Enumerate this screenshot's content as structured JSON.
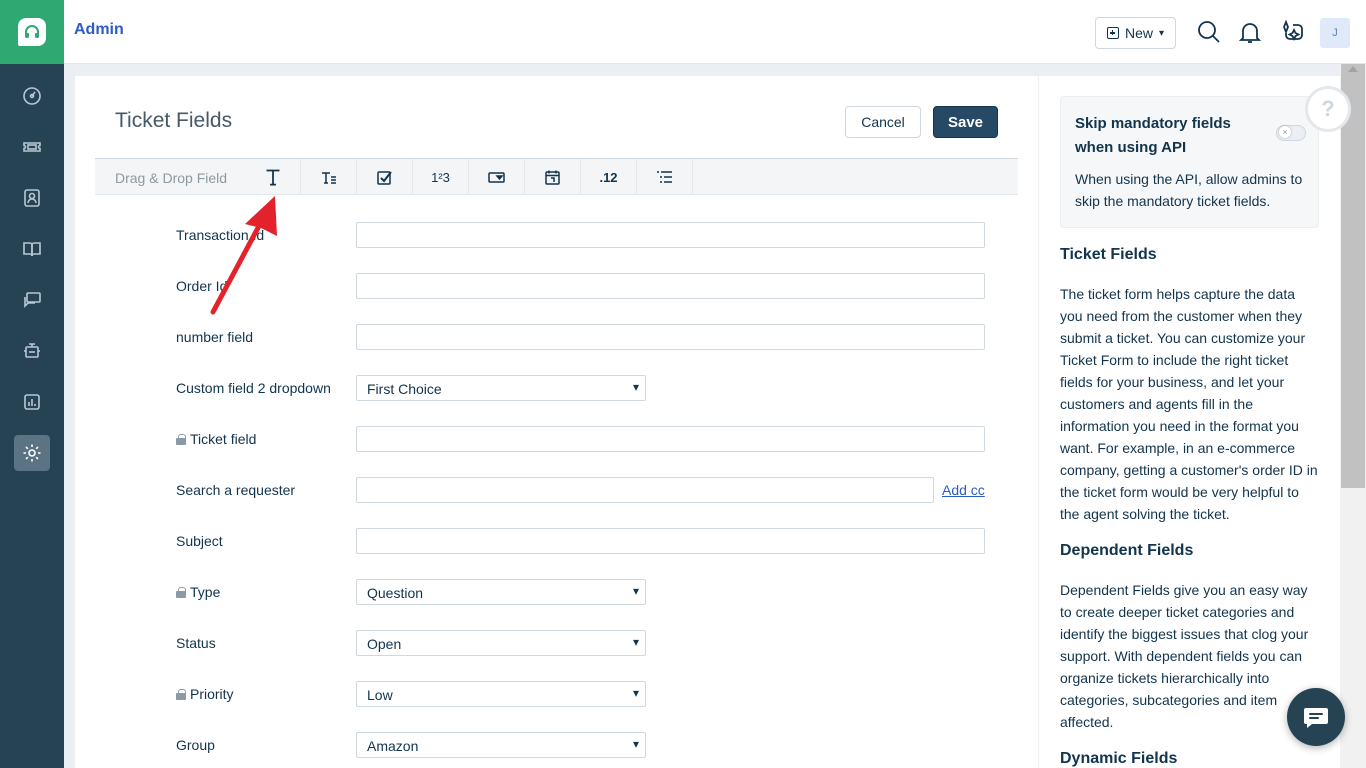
{
  "topbar": {
    "breadcrumb": "Admin",
    "new_button_label": "New",
    "avatar_initial": "J"
  },
  "page": {
    "title": "Ticket Fields",
    "cancel_label": "Cancel",
    "save_label": "Save"
  },
  "toolbar": {
    "label": "Drag & Drop Field",
    "tools": [
      {
        "icon": "single-line-text-icon"
      },
      {
        "icon": "multi-line-text-icon"
      },
      {
        "icon": "checkbox-icon"
      },
      {
        "icon": "number-icon",
        "text": "1²3"
      },
      {
        "icon": "dropdown-icon"
      },
      {
        "icon": "date-icon"
      },
      {
        "icon": "decimal-icon",
        "text": ".12"
      },
      {
        "icon": "dependent-field-icon"
      }
    ]
  },
  "fields": [
    {
      "label": "Transaction Id",
      "type": "text"
    },
    {
      "label": "Order Id",
      "type": "text"
    },
    {
      "label": "number field",
      "type": "text"
    },
    {
      "label": "Custom field 2 dropdown",
      "type": "select",
      "value": "First Choice"
    },
    {
      "label": "Ticket field",
      "type": "text",
      "locked": true
    },
    {
      "label": "Search a requester",
      "type": "text",
      "link": "Add cc"
    },
    {
      "label": "Subject",
      "type": "text"
    },
    {
      "label": "Type",
      "type": "select",
      "value": "Question",
      "locked": true
    },
    {
      "label": "Status",
      "type": "select",
      "value": "Open"
    },
    {
      "label": "Priority",
      "type": "select",
      "value": "Low",
      "locked": true
    },
    {
      "label": "Group",
      "type": "select",
      "value": "Amazon"
    }
  ],
  "sidebar": {
    "skip_title": "Skip mandatory fields when using API",
    "skip_desc": "When using the API, allow admins to skip the mandatory ticket fields.",
    "sections": [
      {
        "heading": "Ticket Fields",
        "body": "The ticket form helps capture the data you need from the customer when they submit a ticket. You can customize your Ticket Form to include the right ticket fields for your business, and let your customers and agents fill in the information you need in the format you want. For example, in an e-commerce company, getting a customer's order ID in the ticket form would be very helpful to the agent solving the ticket."
      },
      {
        "heading": "Dependent Fields",
        "body": "Dependent Fields give you an easy way to create deeper ticket categories and identify the biggest issues that clog your support. With dependent fields you can organize tickets hierarchically into categories, subcategories and item affected."
      },
      {
        "heading": "Dynamic Fields",
        "body": ""
      }
    ]
  },
  "help_symbol": "?",
  "colors": {
    "nav_bg": "#264354",
    "logo_bg": "#2fa871",
    "primary": "#264966",
    "link": "#2c5cc5",
    "annotation_arrow": "#e3222c"
  }
}
